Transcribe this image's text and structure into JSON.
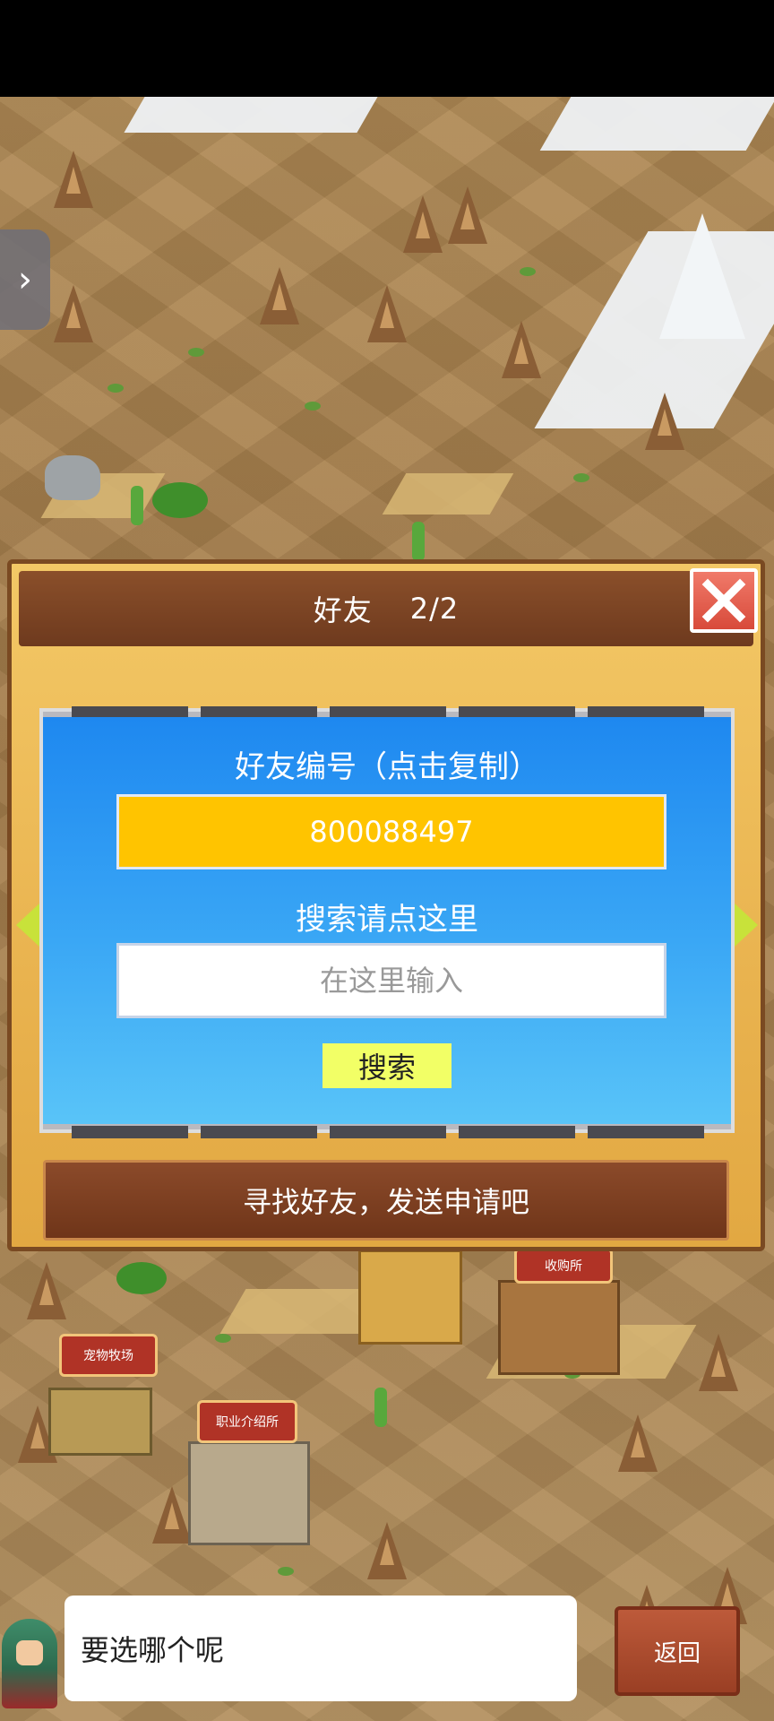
{
  "dialog": {
    "title": "好友",
    "page_indicator": "2/2",
    "friend_id_label": "好友编号（点击复制）",
    "friend_id": "800088497",
    "search_label": "搜索请点这里",
    "search_placeholder": "在这里输入",
    "search_button": "搜索",
    "send_request_banner": "寻找好友，发送申请吧"
  },
  "map": {
    "signs": {
      "pet_ranch": "宠物牧场",
      "job_center": "职业介绍所",
      "purchase_shop": "收购所"
    }
  },
  "bottom_bar": {
    "message": "要选哪个呢",
    "back_button": "返回"
  },
  "colors": {
    "panel_blue": "#1e88f0",
    "id_box_yellow": "#ffc400",
    "search_button_yellow": "#f2ff66",
    "header_brown": "#6e3a1e",
    "close_red": "#d84a3a"
  },
  "icons": {
    "side_tab": "chevron-right-icon",
    "close": "close-icon",
    "prev": "arrow-left-icon",
    "next": "arrow-right-icon"
  }
}
